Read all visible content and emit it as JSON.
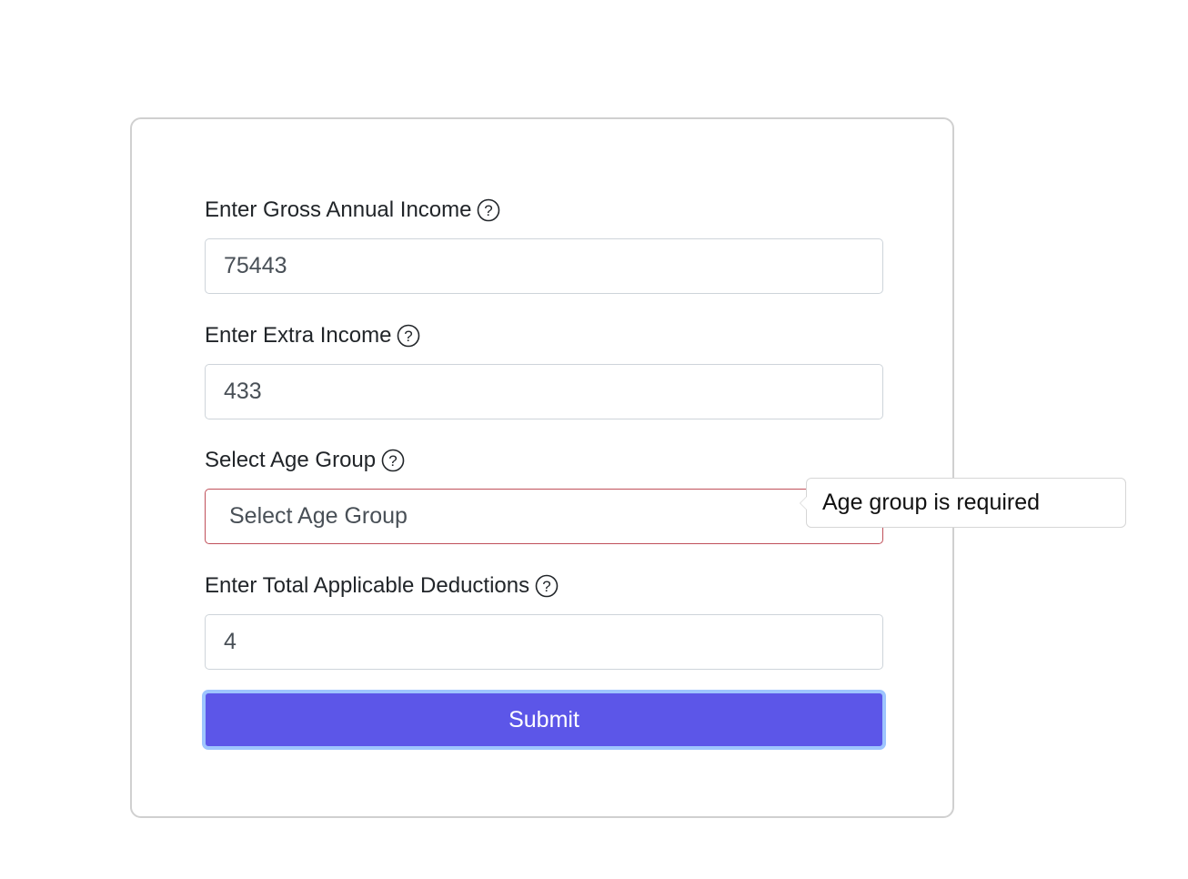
{
  "form": {
    "gross_income": {
      "label": "Enter Gross Annual Income",
      "value": "75443",
      "help_icon": "question-circle-icon"
    },
    "extra_income": {
      "label": "Enter Extra Income",
      "value": "433",
      "help_icon": "question-circle-icon"
    },
    "age_group": {
      "label": "Select Age Group",
      "selected": "Select Age Group",
      "help_icon": "question-circle-icon",
      "error_color": "#c0505a"
    },
    "deductions": {
      "label": "Enter Total Applicable Deductions",
      "value": "4",
      "help_icon": "question-circle-icon"
    },
    "submit_label": "Submit"
  },
  "tooltip": {
    "text": "Age group is required"
  },
  "colors": {
    "button": "#5c56e8",
    "button_focus_ring": "#9ec5fe",
    "card_border": "#d0d0d0"
  }
}
